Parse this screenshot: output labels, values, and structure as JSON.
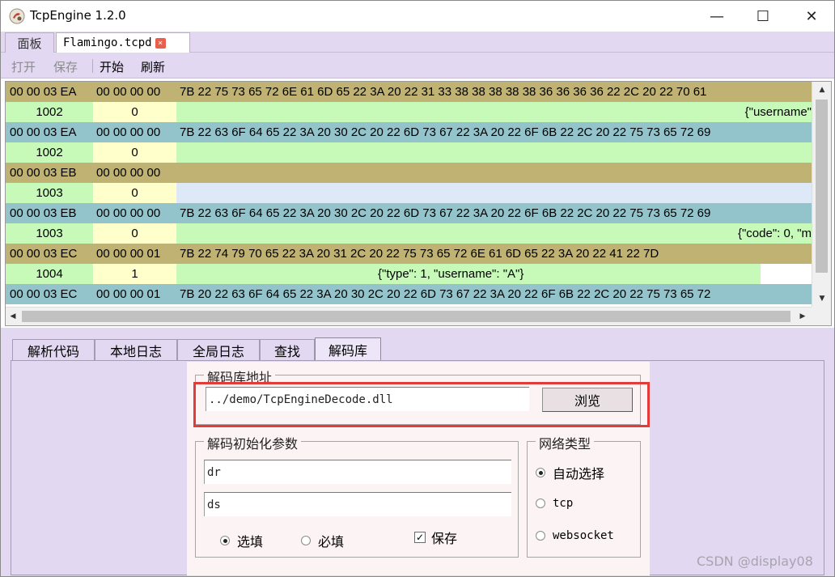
{
  "window": {
    "title": "TcpEngine 1.2.0",
    "controls": {
      "minimize": "—",
      "maximize": "☐",
      "close": "✕"
    }
  },
  "file_tabs": [
    {
      "label": "面板"
    },
    {
      "label": "Flamingo.tcpd",
      "close_icon": "close-icon"
    }
  ],
  "toolbar": {
    "open": "打开",
    "save": "保存",
    "start": "开始",
    "refresh": "刷新"
  },
  "packets": [
    {
      "type": "hex",
      "color": "#bfb272",
      "c1": "00 00 03 EA",
      "c2": "00 00 00 00",
      "c3": "7B 22 75 73 65 72 6E 61 6D 65 22 3A 20 22 31 33 38 38 38 38 38 36 36 36 36 22 2C 20 22 70 61"
    },
    {
      "type": "dec",
      "d1": "1002",
      "d2": "0",
      "d3": "{\"username\"",
      "align": "right"
    },
    {
      "type": "hex",
      "color": "#93c4cc",
      "c1": "00 00 03 EA",
      "c2": "00 00 00 00",
      "c3": "7B 22 63 6F 64 65 22 3A 20 30 2C 20 22 6D 73 67 22 3A 20 22 6F 6B 22 2C 20 22 75 73 65 72 69"
    },
    {
      "type": "dec",
      "d1": "1002",
      "d2": "0",
      "d3": "",
      "align": "left"
    },
    {
      "type": "hex",
      "color": "#bfb272",
      "c1": "00 00 03 EB",
      "c2": "00 00 00 00",
      "c3": ""
    },
    {
      "type": "dec",
      "d1": "1003",
      "d2": "0",
      "d3": "",
      "align": "left",
      "d3bg": "#dde9f7"
    },
    {
      "type": "hex",
      "color": "#93c4cc",
      "c1": "00 00 03 EB",
      "c2": "00 00 00 00",
      "c3": "7B 22 63 6F 64 65 22 3A 20 30 2C 20 22 6D 73 67 22 3A 20 22 6F 6B 22 2C 20 22 75 73 65 72 69"
    },
    {
      "type": "dec",
      "d1": "1003",
      "d2": "0",
      "d3": "{\"code\": 0, \"m",
      "align": "right"
    },
    {
      "type": "hex",
      "color": "#bfb272",
      "c1": "00 00 03 EC",
      "c2": "00 00 00 01",
      "c3": "7B 22 74 79 70 65 22 3A 20 31 2C 20 22 75 73 65 72 6E 61 6D 65 22 3A 20 22 41 22 7D"
    },
    {
      "type": "dec",
      "d1": "1004",
      "d2": "1",
      "d3": "{\"type\": 1, \"username\": \"A\"}",
      "align": "center"
    },
    {
      "type": "hex",
      "color": "#93c4cc",
      "c1": "00 00 03 EC",
      "c2": "00 00 00 01",
      "c3": "7B 20 22 63 6F 64 65 22 3A 20 30 2C 20 22 6D 73 67 22 3A 20 22 6F 6B 22 2C 20 22 75 73 65 72"
    }
  ],
  "bottom_tabs": [
    {
      "label": "解析代码"
    },
    {
      "label": "本地日志"
    },
    {
      "label": "全局日志"
    },
    {
      "label": "查找"
    },
    {
      "label": "解码库",
      "active": true
    }
  ],
  "decoder": {
    "lib_group_label": "解码库地址",
    "lib_path": "../demo/TcpEngineDecode.dll",
    "browse_label": "浏览",
    "init_group_label": "解码初始化参数",
    "init_param_1": "dr",
    "init_param_2": "ds",
    "optional_label": "选填",
    "required_label": "必填",
    "save_label": "保存",
    "net_group_label": "网络类型",
    "net_auto_label": "自动选择",
    "net_tcp_label": "tcp",
    "net_ws_label": "websocket"
  },
  "watermark": "CSDN @display08",
  "colors": {
    "accent_red": "#e33a3a",
    "panel_bg": "#e2d8f1",
    "olive_row": "#bfb272",
    "teal_row": "#93c4cc",
    "green_cell": "#c7f9b9",
    "yellow_cell": "#ffffcc"
  }
}
